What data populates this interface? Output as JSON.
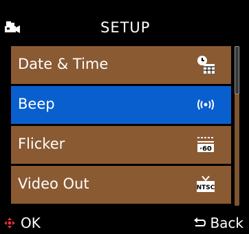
{
  "header": {
    "title": "SETUP",
    "icon": "camcorder-icon"
  },
  "menu": {
    "items": [
      {
        "label": "Date & Time",
        "icon": "clock-calendar-icon",
        "selected": false
      },
      {
        "label": "Beep",
        "icon": "sound-waves-icon",
        "selected": true
      },
      {
        "label": "Flicker",
        "icon": "flicker-60hz-icon",
        "selected": false
      },
      {
        "label": "Video Out",
        "icon": "ntsc-icon",
        "selected": false
      }
    ]
  },
  "footer": {
    "ok_label": "OK",
    "ok_icon": "dpad-icon",
    "back_label": "Back",
    "back_icon": "return-arrow-icon"
  },
  "colors": {
    "row": "#8a5a32",
    "selected_row": "#0a5fcf",
    "background": "#000000",
    "dpad": "#e0303a"
  }
}
